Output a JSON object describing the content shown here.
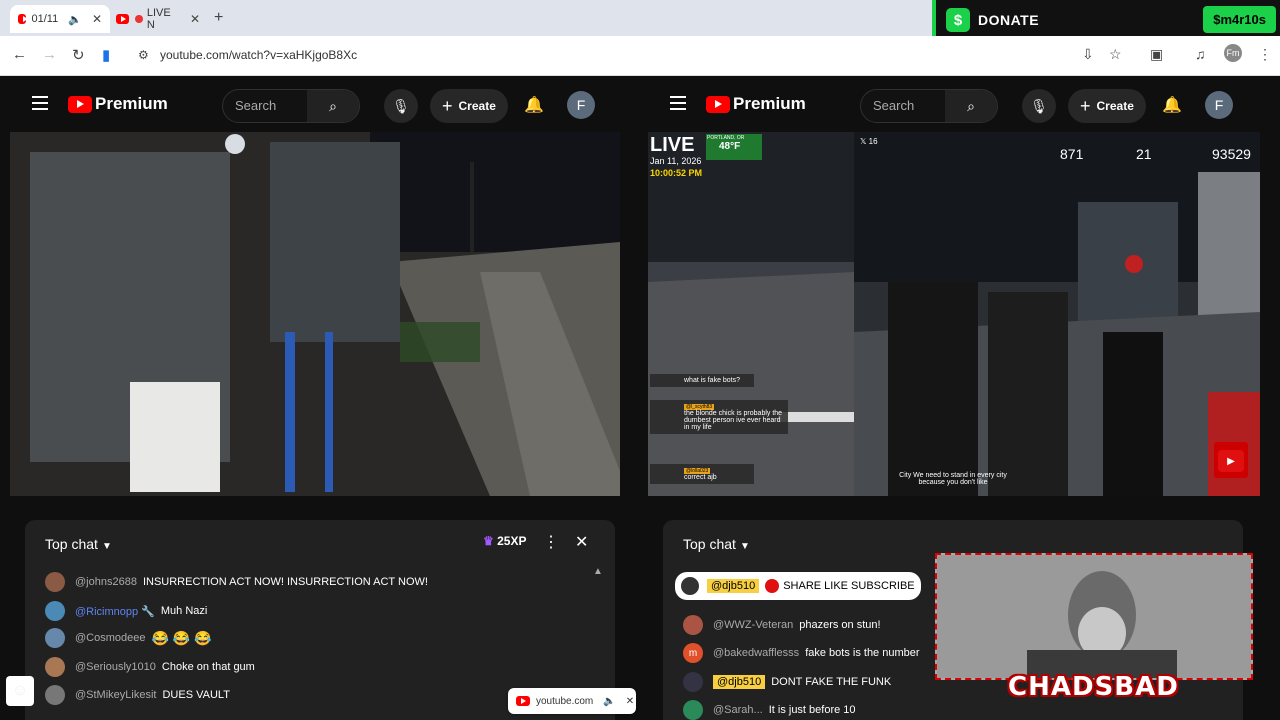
{
  "browser": {
    "tabs": [
      {
        "label": "01/11",
        "muted": true
      },
      {
        "label": "LIVE N"
      }
    ],
    "url": "youtube.com/watch?v=xaHKjgoB8Xc",
    "profile_initial": "Fm"
  },
  "donate": {
    "label": "DONATE",
    "cashtag": "$m4r10s",
    "dollar": "$"
  },
  "left": {
    "logo": "Premium",
    "search_placeholder": "Search",
    "create_label": "Create",
    "avatar": "F",
    "chat": {
      "title": "Top chat",
      "xp": "25XP",
      "messages": [
        {
          "author": "@johns2688",
          "text": "INSURRECTION ACT NOW! INSURRECTION ACT NOW!",
          "color": "#8a5a44"
        },
        {
          "author": "@Ricimnopp 🔧",
          "text": "Muh Nazi",
          "color": "#4a8ab5"
        },
        {
          "author": "@Cosmodeee",
          "text": "😂 😂 😂",
          "color": "#6688aa"
        },
        {
          "author": "@Seriously1010",
          "text": "Choke on that gum",
          "color": "#aa7755"
        },
        {
          "author": "@StMikeyLikesit",
          "text": "DUES VAULT",
          "color": "#777777"
        }
      ]
    }
  },
  "right": {
    "logo": "Premium",
    "search_placeholder": "Search",
    "create_label": "Create",
    "avatar": "F",
    "stream": {
      "live": "LIVE",
      "location": "PORTLAND, OR",
      "temp": "48°F",
      "date": "Jan 11, 2026",
      "time": "10:00:52 PM",
      "viewer_count": "871",
      "chat_rate": "21",
      "views": "93529",
      "x_count": "16",
      "caption": "City We need to stand in every city because you don't like"
    },
    "overlay_chat": [
      {
        "author": "",
        "text": "what is fake bots?"
      },
      {
        "author": "@l_scyth83",
        "text": "the blonde chick is probably the dumbest person ive ever heard in my life"
      },
      {
        "author": "@lolla023",
        "text": "correct ajb"
      }
    ],
    "chat": {
      "title": "Top chat",
      "pinned_author": "@djb510",
      "pinned_text": "SHARE LIKE SUBSCRIBE",
      "messages": [
        {
          "author": "@WWZ-Veteran",
          "text": "phazers on stun!",
          "color": "#aa5544"
        },
        {
          "author": "@bakedwafflesss",
          "text": "fake bots is the number",
          "color": "#e0502a",
          "initial": "m"
        },
        {
          "author": "@djb510",
          "text": "DONT FAKE THE FUNK",
          "color": "#333344",
          "highlight": true
        },
        {
          "author": "@Sarah...",
          "text": "It is just before 10",
          "color": "#2a8a5a"
        }
      ]
    }
  },
  "cam": {
    "brand": "CHADSBAD"
  },
  "popup": {
    "site": "youtube.com"
  }
}
